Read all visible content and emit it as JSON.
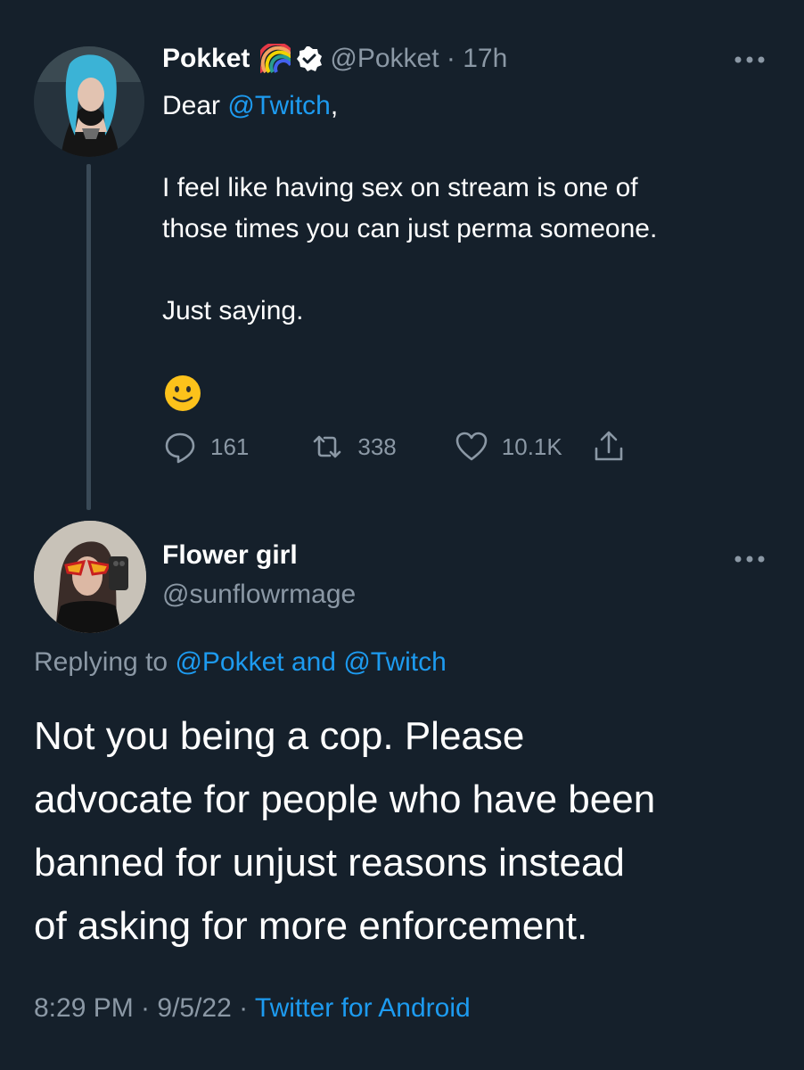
{
  "tweet1": {
    "name": "Pokket",
    "handle_time": "@Pokket · 17h",
    "greeting_prefix": "Dear ",
    "greeting_mention": "@Twitch",
    "greeting_suffix": ",",
    "para1_line1": "I feel like having sex on stream is one of",
    "para1_line2": "those times you can just perma someone.",
    "para2": "Just saying.",
    "emoji": "slightly-smiling-face",
    "replies": "161",
    "retweets": "338",
    "likes": "10.1K"
  },
  "tweet2": {
    "name": "Flower girl",
    "handle": "@sunflowrmage",
    "replying_prefix": "Replying to ",
    "replying_mentions": "@Pokket and @Twitch",
    "text_line1": "Not you being a cop. Please",
    "text_line2": "advocate for people who have been",
    "text_line3": "banned for unjust reasons instead",
    "text_line4": "of asking for more enforcement.",
    "time_date": "8:29 PM · 9/5/22 · ",
    "source": "Twitter for Android"
  },
  "colors": {
    "background": "#15202b",
    "link": "#1d9bf0",
    "muted": "#8b98a5"
  }
}
